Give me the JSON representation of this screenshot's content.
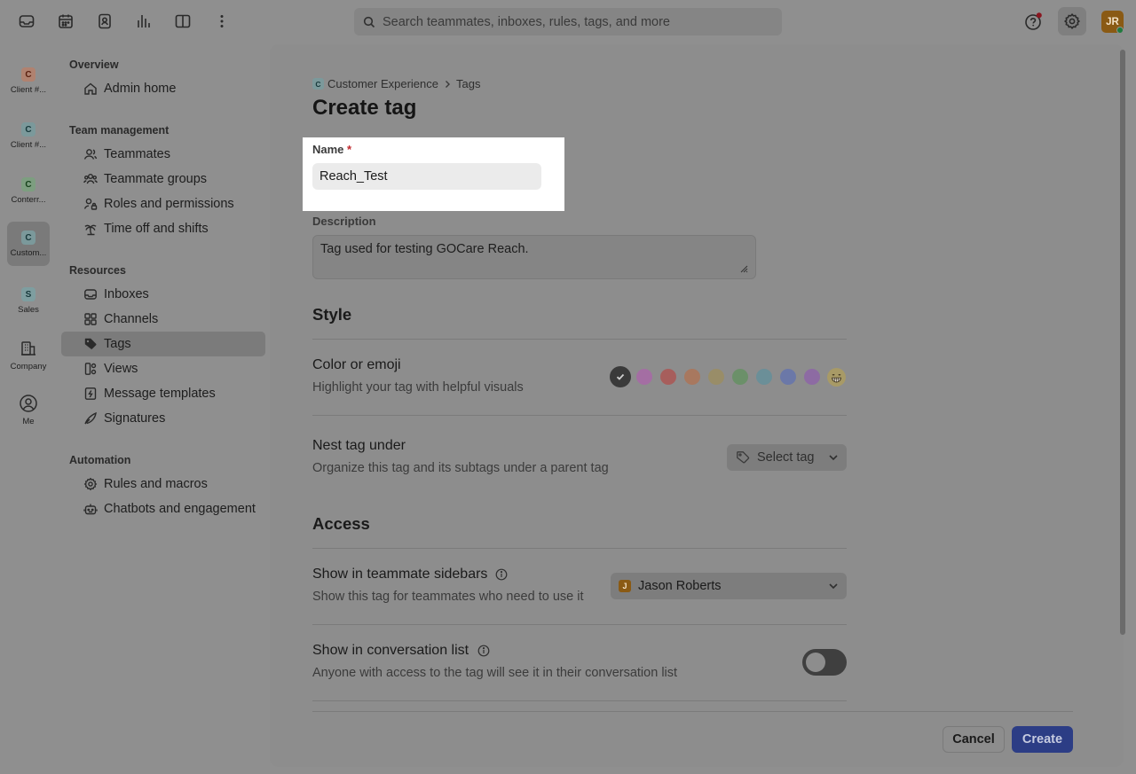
{
  "search": {
    "placeholder": "Search teammates, inboxes, rules, tags, and more"
  },
  "user": {
    "initials": "JR"
  },
  "rail": [
    {
      "badge": "C",
      "label": "Client #...",
      "badge_bg": "#b08270",
      "badge_fg": "#5a2010"
    },
    {
      "badge": "C",
      "label": "Client #...",
      "badge_bg": "#7b999b",
      "badge_fg": "#16383a"
    },
    {
      "badge": "C",
      "label": "Conterr...",
      "badge_bg": "#7d9e80",
      "badge_fg": "#17421b"
    },
    {
      "badge": "C",
      "label": "Custom...",
      "badge_bg": "#7b999b",
      "badge_fg": "#16383a"
    },
    {
      "badge": "S",
      "label": "Sales",
      "badge_bg": "#7e9ea0",
      "badge_fg": "#16383a"
    },
    {
      "label": "Company",
      "icon": "building-icon"
    },
    {
      "label": "Me",
      "icon": "user-circle-icon"
    }
  ],
  "nav": {
    "sections": {
      "overview": "Overview",
      "team": "Team management",
      "resources": "Resources",
      "automation": "Automation"
    },
    "items": {
      "admin_home": "Admin home",
      "teammates": "Teammates",
      "teammate_groups": "Teammate groups",
      "roles": "Roles and permissions",
      "time_off": "Time off and shifts",
      "inboxes": "Inboxes",
      "channels": "Channels",
      "tags": "Tags",
      "views": "Views",
      "message_templates": "Message templates",
      "signatures": "Signatures",
      "rules": "Rules and macros",
      "chatbots": "Chatbots and engagement"
    }
  },
  "breadcrumb": {
    "badge": "C",
    "workspace": "Customer Experience",
    "page": "Tags"
  },
  "page_title": "Create tag",
  "form": {
    "name_label": "Name",
    "required_mark": "*",
    "name_value": "Reach_Test",
    "description_label": "Description",
    "description_value": "Tag used for testing GOCare Reach.",
    "style_title": "Style",
    "color_title": "Color or emoji",
    "color_desc": "Highlight your tag with helpful visuals",
    "colors": [
      "#3a3a3a",
      "#a46ea3",
      "#a75e5c",
      "#a8785f",
      "#998d68",
      "#6b9069",
      "#6b8f98",
      "#6b78a8",
      "#8d6ba3"
    ],
    "selected_color_index": 0,
    "emoji_icon": "grin-emoji-icon",
    "nest_title": "Nest tag under",
    "nest_desc": "Organize this tag and its subtags under a parent tag",
    "nest_placeholder": "Select tag",
    "access_title": "Access",
    "sidebars_title": "Show in teammate sidebars",
    "sidebars_desc": "Show this tag for teammates who need to use it",
    "sidebars_value": "Jason Roberts",
    "sidebars_badge": "J",
    "convo_title": "Show in conversation list",
    "convo_desc": "Anyone with access to the tag will see it in their conversation list",
    "convo_enabled": false
  },
  "buttons": {
    "cancel": "Cancel",
    "create": "Create"
  }
}
